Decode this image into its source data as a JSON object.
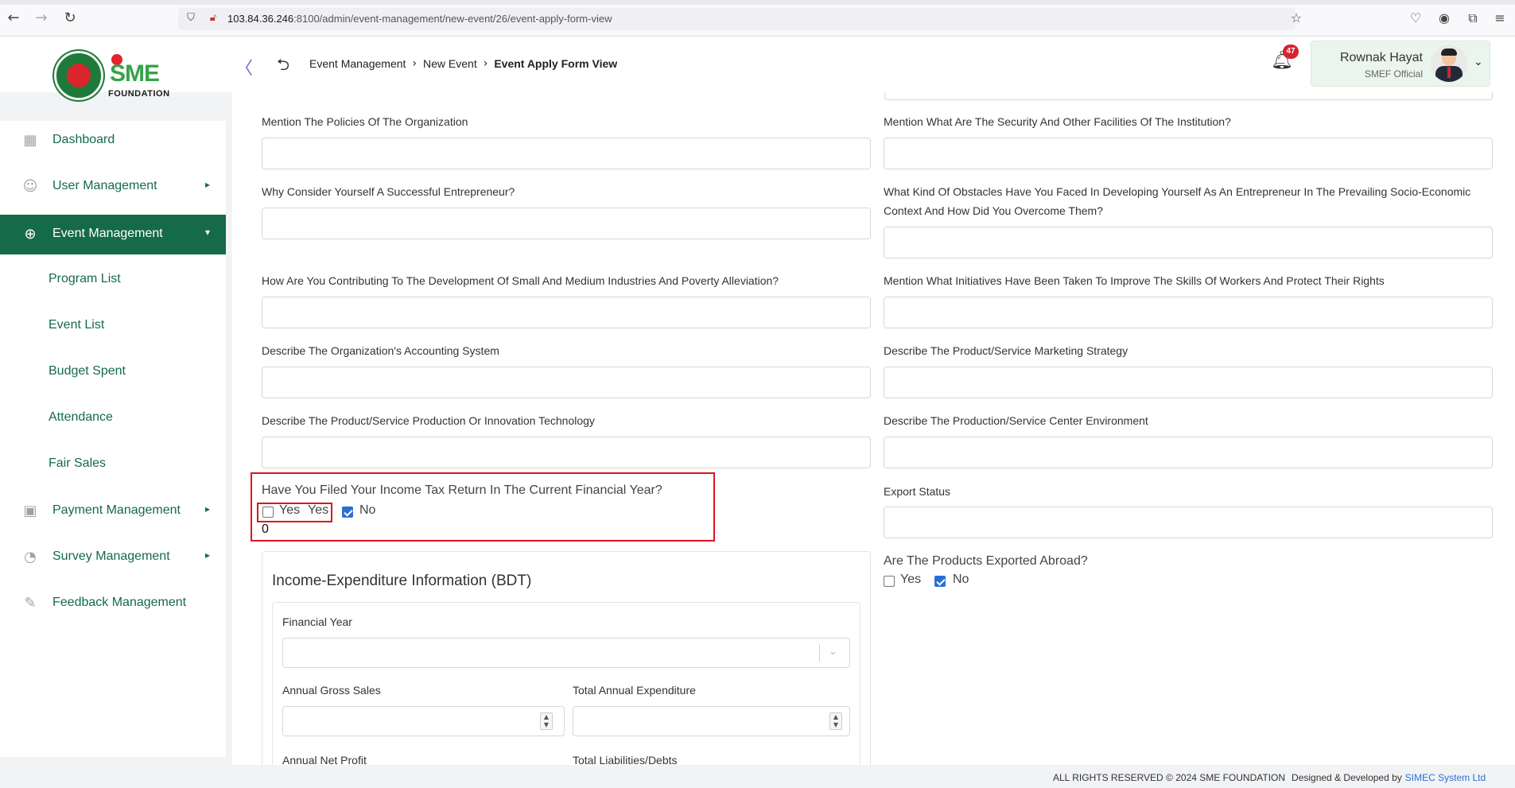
{
  "browser": {
    "url_host": "103.84.36.246",
    "url_rest": ":8100/admin/event-management/new-event/26/event-apply-form-view"
  },
  "header": {
    "logo_org": "FOUNDATION",
    "logo_letters": "SME",
    "breadcrumb": [
      "Event Management",
      "New Event",
      "Event Apply Form View"
    ],
    "notification_count": "47",
    "user_name": "Rownak Hayat",
    "user_role": "SMEF Official"
  },
  "sidebar": {
    "items": [
      {
        "label": "Dashboard",
        "icon": "grid-icon"
      },
      {
        "label": "User Management",
        "icon": "user-icon"
      },
      {
        "label": "Event Management",
        "icon": "lock-icon"
      },
      {
        "label": "Payment Management",
        "icon": "money-icon"
      },
      {
        "label": "Survey Management",
        "icon": "pie-icon"
      },
      {
        "label": "Feedback Management",
        "icon": "feedback-icon"
      }
    ],
    "sub_items": [
      "Program List",
      "Event List",
      "Budget Spent",
      "Attendance",
      "Fair Sales"
    ]
  },
  "form": {
    "q_policies": "Mention The Policies Of The Organization",
    "q_security": "Mention What Are The Security And Other Facilities Of The Institution?",
    "q_successful": "Why Consider Yourself A Successful Entrepreneur?",
    "q_obstacles": "What Kind Of Obstacles Have You Faced In Developing Yourself As An Entrepreneur In The Prevailing Socio-Economic Context And How Did You Overcome Them?",
    "q_contributing": "How Are You Contributing To The Development Of Small And Medium Industries And Poverty Alleviation?",
    "q_initiatives": "Mention What Initiatives Have Been Taken To Improve The Skills Of Workers And Protect Their Rights",
    "q_accounting": "Describe The Organization's Accounting System",
    "q_marketing": "Describe The Product/Service Marketing Strategy",
    "q_production": "Describe The Product/Service Production Or Innovation Technology",
    "q_environment": "Describe The Production/Service Center Environment",
    "q_income_tax": "Have You Filed Your Income Tax Return In The Current Financial Year?",
    "tax_yes_label": "Yes",
    "tax_yes_value": "Yes",
    "tax_no_label": "No",
    "tax_value_display": "0",
    "q_export_status": "Export Status",
    "q_exported_abroad": "Are The Products Exported Abroad?",
    "export_yes_label": "Yes",
    "export_no_label": "No"
  },
  "income_section": {
    "title": "Income-Expenditure Information (BDT)",
    "financial_year": "Financial Year",
    "annual_gross_sales": "Annual Gross Sales",
    "total_annual_expenditure": "Total Annual Expenditure",
    "annual_net_profit": "Annual Net Profit",
    "total_liabilities": "Total Liabilities/Debts"
  },
  "footer": {
    "rights": "ALL RIGHTS RESERVED © 2024 SME FOUNDATION",
    "designed": "Designed & Developed by",
    "brand": "SIMEC System Ltd"
  },
  "colors": {
    "primary": "#156a4a",
    "highlight": "#e0141e",
    "checkbox": "#2a6fd6",
    "badge": "#d6242d"
  }
}
